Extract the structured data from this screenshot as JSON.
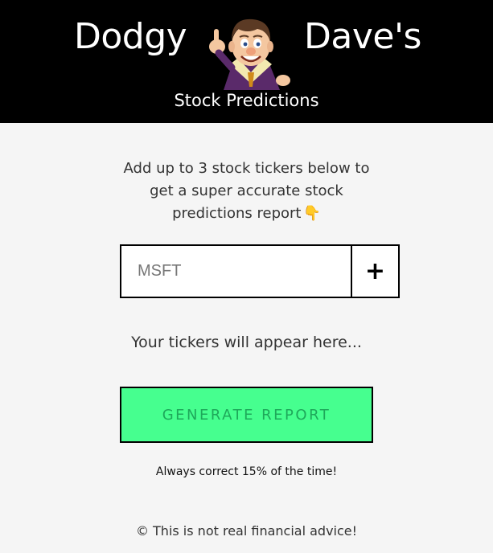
{
  "header": {
    "title_left": "Dodgy",
    "title_right": "Dave's",
    "subtitle": "Stock Predictions",
    "mascot_icon": "cartoon-dave-icon"
  },
  "intro": {
    "text": "Add up to 3 stock tickers below to get a super accurate stock predictions report",
    "emoji": "👇"
  },
  "ticker_form": {
    "placeholder": "MSFT",
    "add_label": "+"
  },
  "tickers_msg": "Your tickers will appear here...",
  "generate_label": "GENERATE REPORT",
  "tagline": "Always correct 15% of the time!",
  "footer": "© This is not real financial advice!",
  "colors": {
    "header_bg": "#000000",
    "page_bg": "#f5f5f5",
    "button_bg": "#46ff8f",
    "button_text": "#1ea85a"
  }
}
